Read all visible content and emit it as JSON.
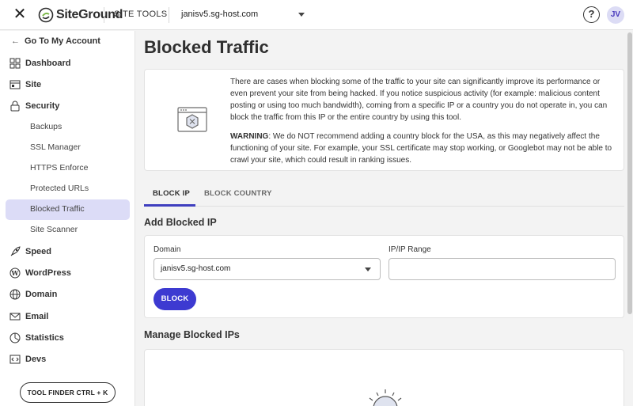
{
  "topbar": {
    "brand": "SiteGround",
    "section": "SITE TOOLS",
    "site": "janisv5.sg-host.com",
    "help_glyph": "?",
    "avatar_initials": "JV"
  },
  "sidebar": {
    "back_link": "Go To My Account",
    "items": [
      {
        "label": "Dashboard",
        "icon": "dashboard-icon"
      },
      {
        "label": "Site",
        "icon": "site-icon"
      },
      {
        "label": "Security",
        "icon": "lock-icon"
      },
      {
        "label": "Speed",
        "icon": "rocket-icon"
      },
      {
        "label": "WordPress",
        "icon": "wordpress-icon"
      },
      {
        "label": "Domain",
        "icon": "globe-icon"
      },
      {
        "label": "Email",
        "icon": "mail-icon"
      },
      {
        "label": "Statistics",
        "icon": "chart-icon"
      },
      {
        "label": "Devs",
        "icon": "code-icon"
      }
    ],
    "security_subitems": [
      "Backups",
      "SSL Manager",
      "HTTPS Enforce",
      "Protected URLs",
      "Blocked Traffic",
      "Site Scanner"
    ],
    "active_subitem": "Blocked Traffic",
    "tool_finder": "TOOL FINDER CTRL + K"
  },
  "main": {
    "title": "Blocked Traffic",
    "info_paragraph": "There are cases when blocking some of the traffic to your site can significantly improve its performance or even prevent your site from being hacked. If you notice suspicious activity (for example: malicious content posting or using too much bandwidth), coming from a specific IP or a country you do not operate in, you can block the traffic from this IP or the entire country by using this tool.",
    "warning_label": "WARNING",
    "warning_text": ": We do NOT recommend adding a country block for the USA, as this may negatively affect the functioning of your site. For example, your SSL certificate may stop working, or Googlebot may not be able to crawl your site, which could result in ranking issues.",
    "tabs": [
      "BLOCK IP",
      "BLOCK COUNTRY"
    ],
    "active_tab": "BLOCK IP",
    "add_heading": "Add Blocked IP",
    "domain_label": "Domain",
    "domain_value": "janisv5.sg-host.com",
    "ip_label": "IP/IP Range",
    "ip_value": "",
    "block_button": "BLOCK",
    "manage_heading": "Manage Blocked IPs"
  },
  "colors": {
    "accent": "#3d3ad1",
    "active_bg": "#dcdcf7",
    "brand_green": "#7bb848"
  }
}
